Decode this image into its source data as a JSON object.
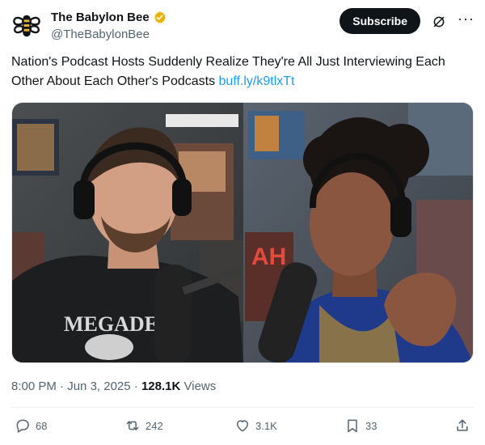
{
  "account": {
    "display_name": "The Babylon Bee",
    "handle": "@TheBabylonBee",
    "verified_color": "#e8b200"
  },
  "header": {
    "subscribe_label": "Subscribe"
  },
  "tweet": {
    "text": "Nation's Podcast Hosts Suddenly Realize They're All Just Interviewing Each Other About Each Other's Podcasts",
    "link": "buff.ly/k9tlxTt"
  },
  "meta": {
    "time": "8:00 PM",
    "separator1": " · ",
    "date": "Jun 3, 2025",
    "separator2": " · ",
    "views_count": "128.1K",
    "views_label": "Views"
  },
  "actions": {
    "replies": "68",
    "reposts": "242",
    "likes": "3.1K",
    "bookmarks": "33"
  },
  "media": {
    "left_shirt_text": "MEGADETH"
  }
}
